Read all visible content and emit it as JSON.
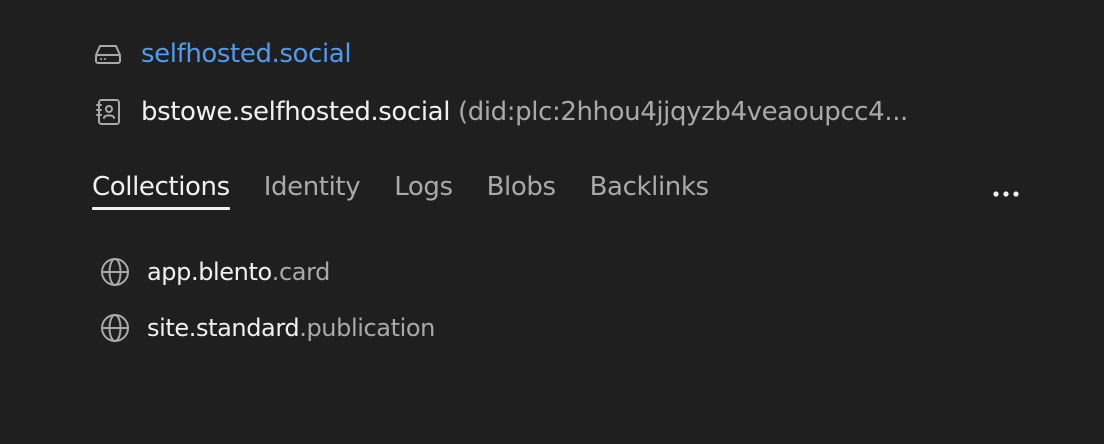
{
  "pds": {
    "icon": "hard-drive-icon",
    "label": "selfhosted.social"
  },
  "account": {
    "icon": "contact-card-icon",
    "handle": "bstowe.selfhosted.social",
    "did": "(did:plc:2hhou4jjqyzb4veaoupcc4..."
  },
  "tabs": [
    {
      "label": "Collections",
      "active": true
    },
    {
      "label": "Identity",
      "active": false
    },
    {
      "label": "Logs",
      "active": false
    },
    {
      "label": "Blobs",
      "active": false
    },
    {
      "label": "Backlinks",
      "active": false
    }
  ],
  "more_menu": {
    "icon": "more-horizontal-icon"
  },
  "collections": [
    {
      "icon": "globe-icon",
      "main": "app.blento",
      "sub": ".card"
    },
    {
      "icon": "globe-icon",
      "main": "site.standard",
      "sub": ".publication"
    }
  ],
  "colors": {
    "background": "#1f1f1f",
    "link": "#4f9bf0",
    "text_primary": "#f0f0f0",
    "text_secondary": "#a9a9a9"
  }
}
